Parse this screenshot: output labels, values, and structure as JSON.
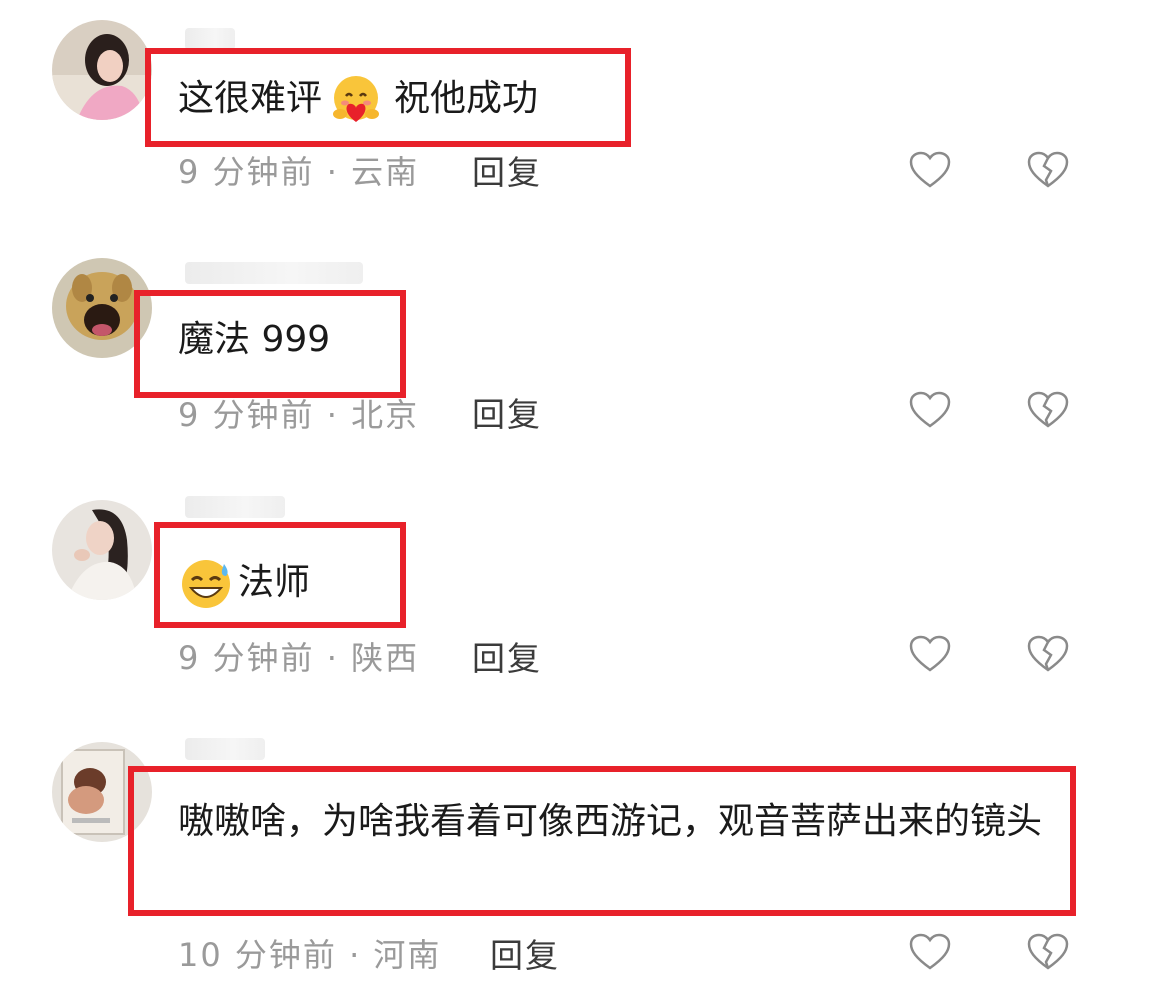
{
  "comments": [
    {
      "text_before": "这很难评",
      "emoji": "hug-heart-emoji",
      "text_after": "祝他成功",
      "time": "9 分钟前",
      "location": "云南",
      "reply_label": "回复"
    },
    {
      "text": "魔法 999",
      "time": "9 分钟前",
      "location": "北京",
      "reply_label": "回复"
    },
    {
      "emoji": "grin-sweat-emoji",
      "text": "法师",
      "time": "9 分钟前",
      "location": "陕西",
      "reply_label": "回复"
    },
    {
      "text": "嗷嗷啥，为啥我看着可像西游记，观音菩萨出来的镜头",
      "time": "10 分钟前",
      "location": "河南",
      "reply_label": "回复"
    }
  ],
  "meta_separator": " · ",
  "colors": {
    "highlight_box": "#e8212a",
    "meta_text": "#9a9a9a"
  },
  "icons": [
    "heart-outline-icon",
    "broken-heart-icon"
  ]
}
